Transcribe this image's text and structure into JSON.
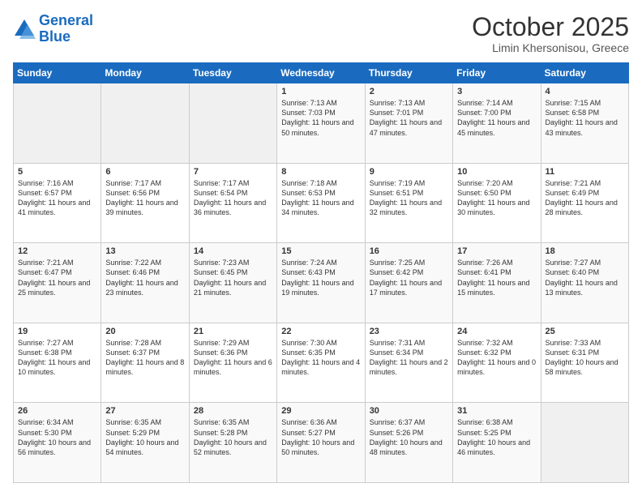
{
  "logo": {
    "line1": "General",
    "line2": "Blue"
  },
  "header": {
    "month": "October 2025",
    "location": "Limin Khersonisou, Greece"
  },
  "weekdays": [
    "Sunday",
    "Monday",
    "Tuesday",
    "Wednesday",
    "Thursday",
    "Friday",
    "Saturday"
  ],
  "weeks": [
    [
      {
        "day": "",
        "text": ""
      },
      {
        "day": "",
        "text": ""
      },
      {
        "day": "",
        "text": ""
      },
      {
        "day": "1",
        "text": "Sunrise: 7:13 AM\nSunset: 7:03 PM\nDaylight: 11 hours\nand 50 minutes."
      },
      {
        "day": "2",
        "text": "Sunrise: 7:13 AM\nSunset: 7:01 PM\nDaylight: 11 hours\nand 47 minutes."
      },
      {
        "day": "3",
        "text": "Sunrise: 7:14 AM\nSunset: 7:00 PM\nDaylight: 11 hours\nand 45 minutes."
      },
      {
        "day": "4",
        "text": "Sunrise: 7:15 AM\nSunset: 6:58 PM\nDaylight: 11 hours\nand 43 minutes."
      }
    ],
    [
      {
        "day": "5",
        "text": "Sunrise: 7:16 AM\nSunset: 6:57 PM\nDaylight: 11 hours\nand 41 minutes."
      },
      {
        "day": "6",
        "text": "Sunrise: 7:17 AM\nSunset: 6:56 PM\nDaylight: 11 hours\nand 39 minutes."
      },
      {
        "day": "7",
        "text": "Sunrise: 7:17 AM\nSunset: 6:54 PM\nDaylight: 11 hours\nand 36 minutes."
      },
      {
        "day": "8",
        "text": "Sunrise: 7:18 AM\nSunset: 6:53 PM\nDaylight: 11 hours\nand 34 minutes."
      },
      {
        "day": "9",
        "text": "Sunrise: 7:19 AM\nSunset: 6:51 PM\nDaylight: 11 hours\nand 32 minutes."
      },
      {
        "day": "10",
        "text": "Sunrise: 7:20 AM\nSunset: 6:50 PM\nDaylight: 11 hours\nand 30 minutes."
      },
      {
        "day": "11",
        "text": "Sunrise: 7:21 AM\nSunset: 6:49 PM\nDaylight: 11 hours\nand 28 minutes."
      }
    ],
    [
      {
        "day": "12",
        "text": "Sunrise: 7:21 AM\nSunset: 6:47 PM\nDaylight: 11 hours\nand 25 minutes."
      },
      {
        "day": "13",
        "text": "Sunrise: 7:22 AM\nSunset: 6:46 PM\nDaylight: 11 hours\nand 23 minutes."
      },
      {
        "day": "14",
        "text": "Sunrise: 7:23 AM\nSunset: 6:45 PM\nDaylight: 11 hours\nand 21 minutes."
      },
      {
        "day": "15",
        "text": "Sunrise: 7:24 AM\nSunset: 6:43 PM\nDaylight: 11 hours\nand 19 minutes."
      },
      {
        "day": "16",
        "text": "Sunrise: 7:25 AM\nSunset: 6:42 PM\nDaylight: 11 hours\nand 17 minutes."
      },
      {
        "day": "17",
        "text": "Sunrise: 7:26 AM\nSunset: 6:41 PM\nDaylight: 11 hours\nand 15 minutes."
      },
      {
        "day": "18",
        "text": "Sunrise: 7:27 AM\nSunset: 6:40 PM\nDaylight: 11 hours\nand 13 minutes."
      }
    ],
    [
      {
        "day": "19",
        "text": "Sunrise: 7:27 AM\nSunset: 6:38 PM\nDaylight: 11 hours\nand 10 minutes."
      },
      {
        "day": "20",
        "text": "Sunrise: 7:28 AM\nSunset: 6:37 PM\nDaylight: 11 hours\nand 8 minutes."
      },
      {
        "day": "21",
        "text": "Sunrise: 7:29 AM\nSunset: 6:36 PM\nDaylight: 11 hours\nand 6 minutes."
      },
      {
        "day": "22",
        "text": "Sunrise: 7:30 AM\nSunset: 6:35 PM\nDaylight: 11 hours\nand 4 minutes."
      },
      {
        "day": "23",
        "text": "Sunrise: 7:31 AM\nSunset: 6:34 PM\nDaylight: 11 hours\nand 2 minutes."
      },
      {
        "day": "24",
        "text": "Sunrise: 7:32 AM\nSunset: 6:32 PM\nDaylight: 11 hours\nand 0 minutes."
      },
      {
        "day": "25",
        "text": "Sunrise: 7:33 AM\nSunset: 6:31 PM\nDaylight: 10 hours\nand 58 minutes."
      }
    ],
    [
      {
        "day": "26",
        "text": "Sunrise: 6:34 AM\nSunset: 5:30 PM\nDaylight: 10 hours\nand 56 minutes."
      },
      {
        "day": "27",
        "text": "Sunrise: 6:35 AM\nSunset: 5:29 PM\nDaylight: 10 hours\nand 54 minutes."
      },
      {
        "day": "28",
        "text": "Sunrise: 6:35 AM\nSunset: 5:28 PM\nDaylight: 10 hours\nand 52 minutes."
      },
      {
        "day": "29",
        "text": "Sunrise: 6:36 AM\nSunset: 5:27 PM\nDaylight: 10 hours\nand 50 minutes."
      },
      {
        "day": "30",
        "text": "Sunrise: 6:37 AM\nSunset: 5:26 PM\nDaylight: 10 hours\nand 48 minutes."
      },
      {
        "day": "31",
        "text": "Sunrise: 6:38 AM\nSunset: 5:25 PM\nDaylight: 10 hours\nand 46 minutes."
      },
      {
        "day": "",
        "text": ""
      }
    ]
  ]
}
